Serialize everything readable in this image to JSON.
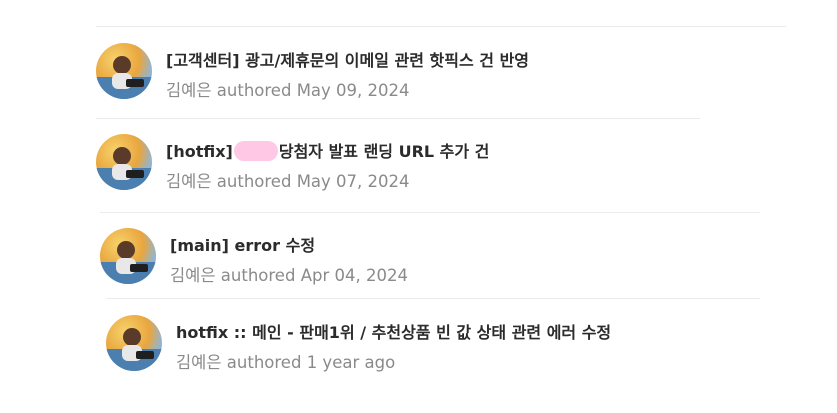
{
  "commits": [
    {
      "title": "[고객센터] 광고/제휴문의 이메일 관련 핫픽스 건 반영",
      "author": "김예은",
      "verb": "authored",
      "date": "May 09, 2024"
    },
    {
      "title_prefix": "[hotfix]",
      "title_suffix": "당첨자 발표 랜딩 URL 추가 건",
      "author": "김예은",
      "verb": "authored",
      "date": "May 07, 2024"
    },
    {
      "title": "[main] error 수정",
      "author": "김예은",
      "verb": "authored",
      "date": "Apr 04, 2024"
    },
    {
      "title": "hotfix :: 메인 - 판매1위 / 추천상품 빈 값 상태 관련 에러 수정",
      "author": "김예은",
      "verb": "authored",
      "date": "1 year ago"
    }
  ]
}
